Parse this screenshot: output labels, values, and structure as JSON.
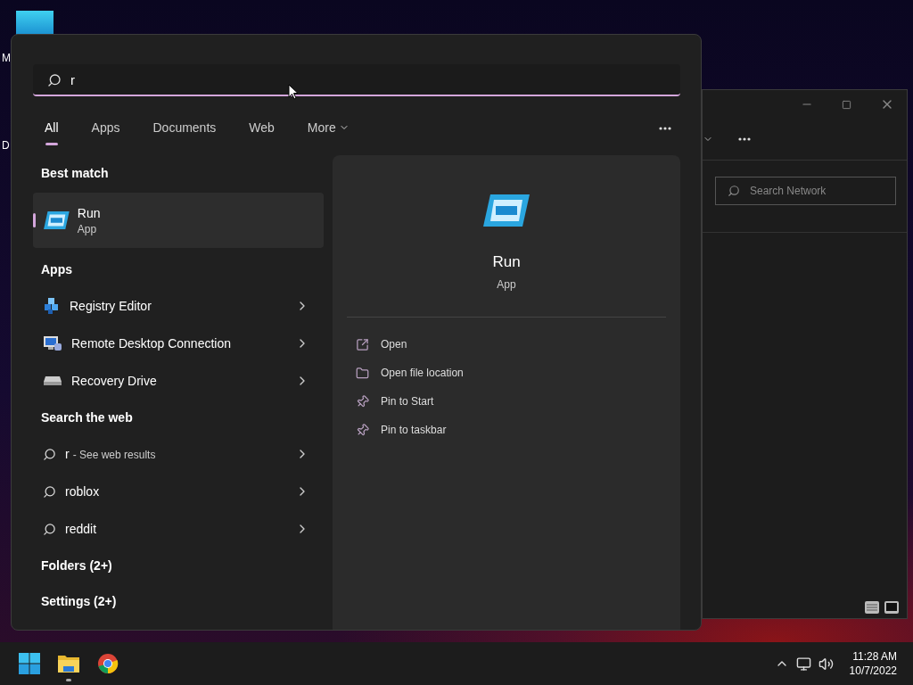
{
  "desktop": {
    "icon_labels": [
      {
        "label": "M"
      },
      {
        "label": "D"
      }
    ]
  },
  "explorer_window": {
    "search": {
      "placeholder": "Search Network"
    }
  },
  "search_panel": {
    "query": "r",
    "tabs": [
      {
        "label": "All",
        "selected": true,
        "kind": "plain"
      },
      {
        "label": "Apps",
        "selected": false,
        "kind": "plain"
      },
      {
        "label": "Documents",
        "selected": false,
        "kind": "plain"
      },
      {
        "label": "Web",
        "selected": false,
        "kind": "plain"
      },
      {
        "label": "More",
        "selected": false,
        "kind": "dropdown"
      }
    ],
    "best_match": {
      "heading": "Best match",
      "title": "Run",
      "subtitle": "App",
      "selected": true
    },
    "apps": {
      "heading": "Apps",
      "items": [
        {
          "label": "Registry Editor",
          "kind": "registry"
        },
        {
          "label": "Remote Desktop Connection",
          "kind": "remote"
        },
        {
          "label": "Recovery Drive",
          "kind": "drive"
        }
      ]
    },
    "web": {
      "heading": "Search the web",
      "items": [
        {
          "query": "r",
          "hint": "- See web results"
        },
        {
          "query": "roblox"
        },
        {
          "query": "reddit"
        }
      ]
    },
    "more_groups": [
      {
        "label": "Folders (2+)"
      },
      {
        "label": "Settings (2+)"
      }
    ],
    "detail": {
      "title": "Run",
      "subtitle": "App",
      "actions": [
        {
          "label": "Open",
          "kind": "open"
        },
        {
          "label": "Open file location",
          "kind": "folder"
        },
        {
          "label": "Pin to Start",
          "kind": "pin"
        },
        {
          "label": "Pin to taskbar",
          "kind": "pin"
        }
      ]
    }
  },
  "taskbar": {
    "apps": [
      {
        "kind": "start",
        "running": false
      },
      {
        "kind": "explorer",
        "running": true
      },
      {
        "kind": "browser",
        "running": false
      }
    ],
    "time": "11:28 AM",
    "date": "10/7/2022"
  }
}
